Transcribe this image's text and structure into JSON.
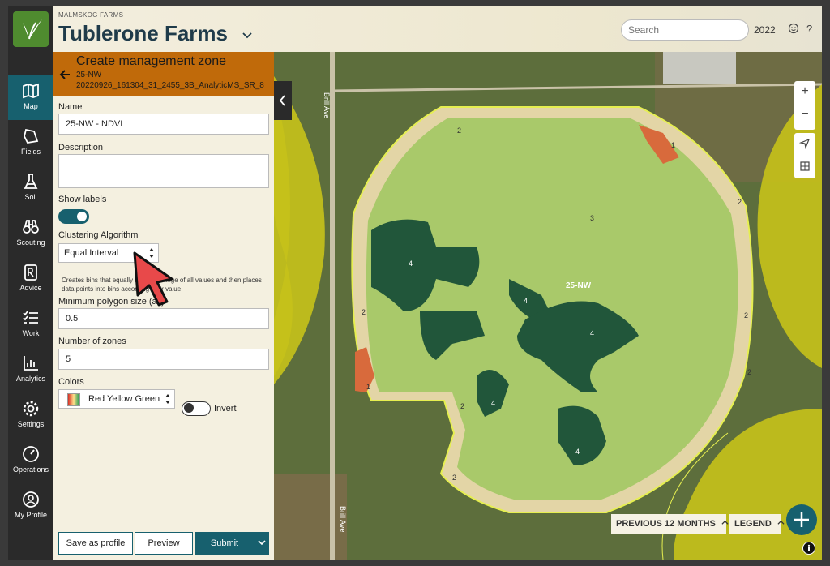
{
  "org": "MALMSKOG FARMS",
  "farm_name": "Tublerone Farms",
  "search_placeholder": "Search",
  "year": "2022",
  "nav": [
    {
      "label": "Map"
    },
    {
      "label": "Fields"
    },
    {
      "label": "Soil"
    },
    {
      "label": "Scouting"
    },
    {
      "label": "Advice"
    },
    {
      "label": "Work"
    },
    {
      "label": "Analytics"
    },
    {
      "label": "Settings"
    },
    {
      "label": "Operations"
    },
    {
      "label": "My Profile"
    }
  ],
  "panel": {
    "title": "Create management zone",
    "field": "25-NW",
    "image_id": "20220926_161304_31_2455_3B_AnalyticMS_SR_8",
    "name_label": "Name",
    "name_value": "25-NW - NDVI",
    "description_label": "Description",
    "show_labels_label": "Show labels",
    "show_labels_on": true,
    "algorithm_label": "Clustering Algorithm",
    "algorithm_value": "Equal Interval",
    "algorithm_help": "Creates bins that equally span the range of all values and then places data points into bins according their value",
    "min_polygon_label": "Minimum polygon size (ac)",
    "min_polygon_value": "0.5",
    "zones_label": "Number of zones",
    "zones_value": "5",
    "colors_label": "Colors",
    "colors_value": "Red Yellow Green",
    "invert_label": "Invert",
    "invert_on": false,
    "save_profile_label": "Save as profile",
    "preview_label": "Preview",
    "submit_label": "Submit"
  },
  "map": {
    "field_label": "25-NW",
    "road_label_1": "Brill Ave",
    "road_label_2": "Brill Ave",
    "zone_labels": [
      "2",
      "1",
      "2",
      "3",
      "4",
      "4",
      "2",
      "4",
      "2",
      "2",
      "1",
      "2",
      "4",
      "4",
      "2"
    ],
    "zoom_in": "+",
    "zoom_out": "−",
    "previous_label": "PREVIOUS 12 MONTHS",
    "legend_label": "LEGEND",
    "colors": {
      "zone1": "#d86a3c",
      "zone2": "#e3d5a6",
      "zone3": "#a9c96a",
      "zone4": "#21563a",
      "boundary": "#e6ef50"
    }
  }
}
